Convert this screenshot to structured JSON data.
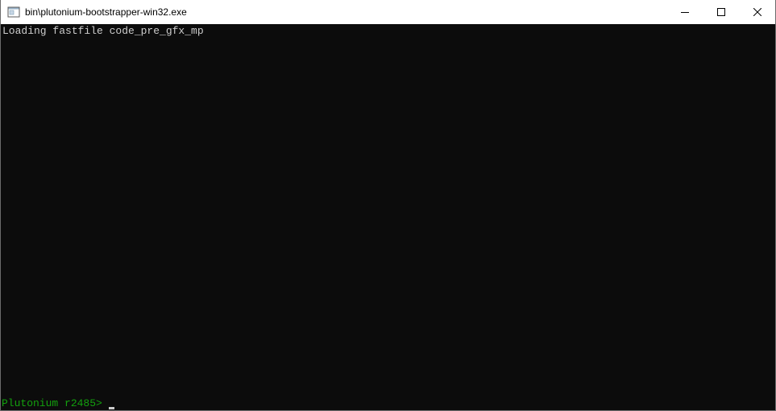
{
  "window": {
    "title": "bin\\plutonium-bootstrapper-win32.exe",
    "icon": "console-app-icon",
    "controls": {
      "minimize_icon": "minimize-icon",
      "maximize_icon": "maximize-icon",
      "close_icon": "close-icon"
    }
  },
  "console": {
    "lines": [
      "Loading fastfile code_pre_gfx_mp"
    ],
    "prompt": "Plutonium r2485>",
    "colors": {
      "background": "#0c0c0c",
      "text": "#cccccc",
      "prompt": "#13a10e"
    }
  }
}
